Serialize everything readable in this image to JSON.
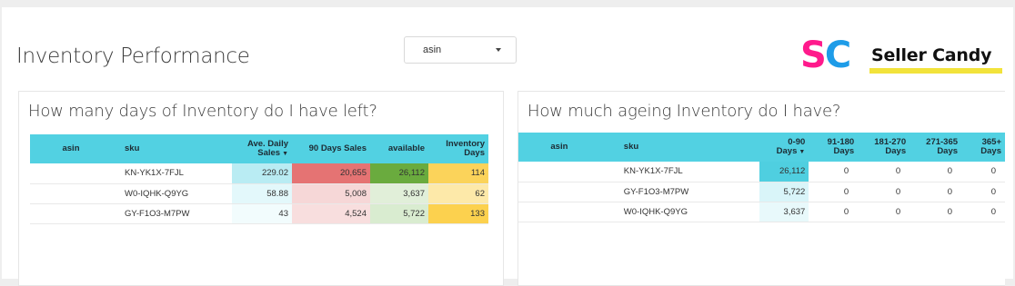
{
  "header": {
    "title": "Inventory Performance",
    "dropdown_label": "asin"
  },
  "brand": {
    "logo_mark": "SC",
    "name": "Seller Candy",
    "colors": {
      "s": "#ff1a8c",
      "c": "#1e9ce8",
      "underline": "#f2e33b"
    }
  },
  "left_panel": {
    "title": "How many days of Inventory do I have left?",
    "columns": {
      "asin": "asin",
      "sku": "sku",
      "ave_daily_sales_l1": "Ave. Daily",
      "ave_daily_sales_l2": "Sales",
      "ninety_days_sales": "90 Days Sales",
      "available": "available",
      "inventory_days_l1": "Inventory",
      "inventory_days_l2": "Days"
    },
    "rows": [
      {
        "asin": "",
        "sku": "KN-YK1X-7FJL",
        "ave_daily_sales": "229.02",
        "ninety_days_sales": "20,655",
        "available": "26,112",
        "inventory_days": "114"
      },
      {
        "asin": "",
        "sku": "W0-IQHK-Q9YG",
        "ave_daily_sales": "58.88",
        "ninety_days_sales": "5,008",
        "available": "3,637",
        "inventory_days": "62"
      },
      {
        "asin": "",
        "sku": "GY-F1O3-M7PW",
        "ave_daily_sales": "43",
        "ninety_days_sales": "4,524",
        "available": "5,722",
        "inventory_days": "133"
      }
    ],
    "cell_colors": [
      {
        "ave": "#b9ecf3",
        "ninety": "#e57373",
        "available": "#6aab3e",
        "days": "#fbd35a"
      },
      {
        "ave": "#e3f8fb",
        "ninety": "#f6d7d7",
        "available": "#e1efd9",
        "days": "#fde9a9"
      },
      {
        "ave": "#f2fcfd",
        "ninety": "#f8dede",
        "available": "#d9ecd0",
        "days": "#fcd14e"
      }
    ]
  },
  "right_panel": {
    "title": "How much ageing Inventory do I have?",
    "columns": {
      "asin": "asin",
      "sku": "sku",
      "d0_90_l1": "0-90",
      "d0_90_l2": "Days",
      "d91_180_l1": "91-180",
      "d91_180_l2": "Days",
      "d181_270_l1": "181-270",
      "d181_270_l2": "Days",
      "d271_365_l1": "271-365",
      "d271_365_l2": "Days",
      "d365_l1": "365+",
      "d365_l2": "Days"
    },
    "rows": [
      {
        "asin": "",
        "sku": "KN-YK1X-7FJL",
        "d0_90": "26,112",
        "d91_180": "0",
        "d181_270": "0",
        "d271_365": "0",
        "d365": "0"
      },
      {
        "asin": "",
        "sku": "GY-F1O3-M7PW",
        "d0_90": "5,722",
        "d91_180": "0",
        "d181_270": "0",
        "d271_365": "0",
        "d365": "0"
      },
      {
        "asin": "",
        "sku": "W0-IQHK-Q9YG",
        "d0_90": "3,637",
        "d91_180": "0",
        "d181_270": "0",
        "d271_365": "0",
        "d365": "0"
      }
    ],
    "cell_colors": [
      "#4fcfe0",
      "#d9f5f9",
      "#e8f9fb"
    ]
  }
}
